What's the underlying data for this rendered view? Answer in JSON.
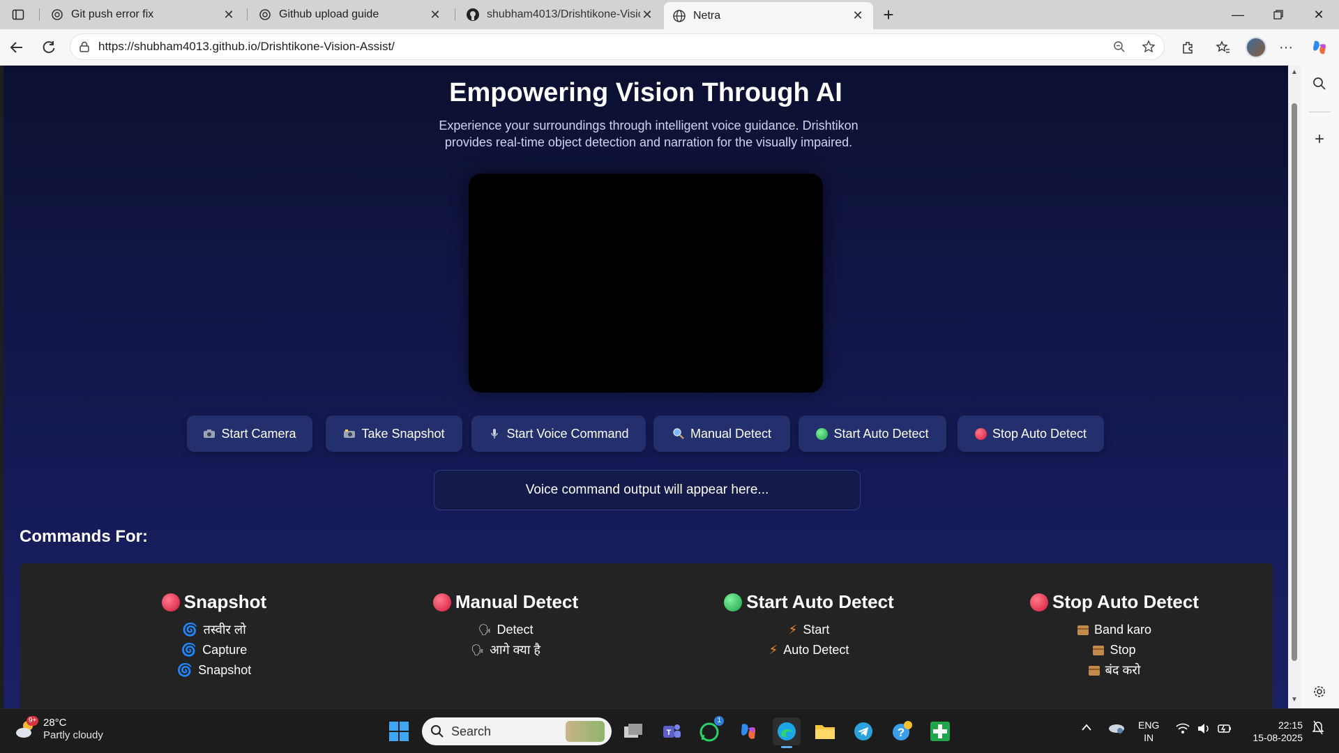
{
  "browser": {
    "tabs": [
      {
        "title": "Git push error fix",
        "favicon": "chatgpt-icon"
      },
      {
        "title": "Github upload guide",
        "favicon": "chatgpt-icon"
      },
      {
        "title": "shubham4013/Drishtikone-Vision",
        "favicon": "github-icon"
      },
      {
        "title": "Netra",
        "favicon": "globe-icon"
      }
    ],
    "url": "https://shubham4013.github.io/Drishtikone-Vision-Assist/"
  },
  "page": {
    "title": "Empowering Vision Through AI",
    "subtitle": "Experience your surroundings through intelligent voice guidance. Drishtikon provides real-time object detection and narration for the visually impaired.",
    "buttons": [
      {
        "label": "Start Camera",
        "icon": "camera-icon"
      },
      {
        "label": "Take Snapshot",
        "icon": "camera-flash-icon"
      },
      {
        "label": "Start Voice Command",
        "icon": "microphone-icon"
      },
      {
        "label": "Manual Detect",
        "icon": "magnifier-icon"
      },
      {
        "label": "Start Auto Detect",
        "icon": "green-circle-icon"
      },
      {
        "label": "Stop Auto Detect",
        "icon": "red-circle-icon"
      }
    ],
    "output_placeholder": "Voice command output will appear here...",
    "commands_heading": "Commands For:",
    "commands": [
      {
        "title": "Snapshot",
        "marker": "red",
        "items": [
          "तस्वीर लो",
          "Capture",
          "Snapshot"
        ]
      },
      {
        "title": "Manual Detect",
        "marker": "red",
        "items": [
          "Detect",
          "आगे क्या है"
        ]
      },
      {
        "title": "Start Auto Detect",
        "marker": "green",
        "items": [
          "Start",
          "Auto Detect"
        ]
      },
      {
        "title": "Stop Auto Detect",
        "marker": "red",
        "items": [
          "Band karo",
          "Stop",
          "बंद करो"
        ]
      }
    ]
  },
  "taskbar": {
    "weather_temp": "28°C",
    "weather_cond": "Partly cloudy",
    "weather_badge": "9+",
    "search_placeholder": "Search",
    "whatsapp_badge": "1",
    "lang_top": "ENG",
    "lang_bottom": "IN",
    "time": "22:15",
    "date": "15-08-2025"
  },
  "colors": {
    "page_bg_top": "#0c1030",
    "page_bg_bottom": "#1a2064",
    "button_bg": "#24306e",
    "panel_bg": "#232323"
  }
}
